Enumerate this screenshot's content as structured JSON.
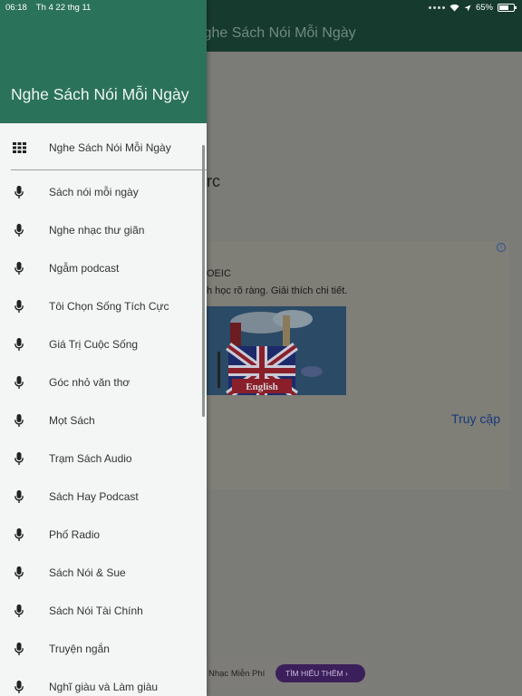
{
  "status_bar": {
    "time": "06:18",
    "date": "Th 4 22 thg 11",
    "battery": "65%"
  },
  "background": {
    "app_title": "Nghe Sách Nói Mỗi Ngày",
    "content_fragment": "rc",
    "ad": {
      "line1": "OEIC",
      "line2": "h học rõ ràng. Giải thích chi tiết.",
      "image_text": "English",
      "cta": "Truy cập"
    },
    "bottom_ad": {
      "text": "Nhạc Miễn Phí",
      "button": "TÌM HIỂU THÊM"
    }
  },
  "drawer": {
    "title": "Nghe Sách Nói Mỗi Ngày",
    "top_item": {
      "label": "Nghe Sách Nói Mỗi Ngày",
      "icon": "grid-icon"
    },
    "items": [
      {
        "label": "Sách nói mỗi ngày",
        "icon": "microphone-icon"
      },
      {
        "label": "Nghe nhạc thư giãn",
        "icon": "microphone-icon"
      },
      {
        "label": "Ngẫm podcast",
        "icon": "microphone-icon"
      },
      {
        "label": "Tôi Chọn Sống Tích Cực",
        "icon": "microphone-icon"
      },
      {
        "label": "Giá Trị Cuộc Sống",
        "icon": "microphone-icon"
      },
      {
        "label": "Góc nhỏ văn thơ",
        "icon": "microphone-icon"
      },
      {
        "label": "Mọt Sách",
        "icon": "microphone-icon"
      },
      {
        "label": "Trạm Sách Audio",
        "icon": "microphone-icon"
      },
      {
        "label": "Sách Hay Podcast",
        "icon": "microphone-icon"
      },
      {
        "label": "Phố Radio",
        "icon": "microphone-icon"
      },
      {
        "label": "Sách Nói & Sue",
        "icon": "microphone-icon"
      },
      {
        "label": "Sách Nói Tài Chính",
        "icon": "microphone-icon"
      },
      {
        "label": "Truyện ngắn",
        "icon": "microphone-icon"
      },
      {
        "label": "Nghĩ giàu và Làm giàu",
        "icon": "microphone-icon"
      }
    ]
  },
  "colors": {
    "drawer_header": "#2b725a",
    "app_bar": "#173a2f",
    "drawer_bg": "#f3f6f4"
  }
}
